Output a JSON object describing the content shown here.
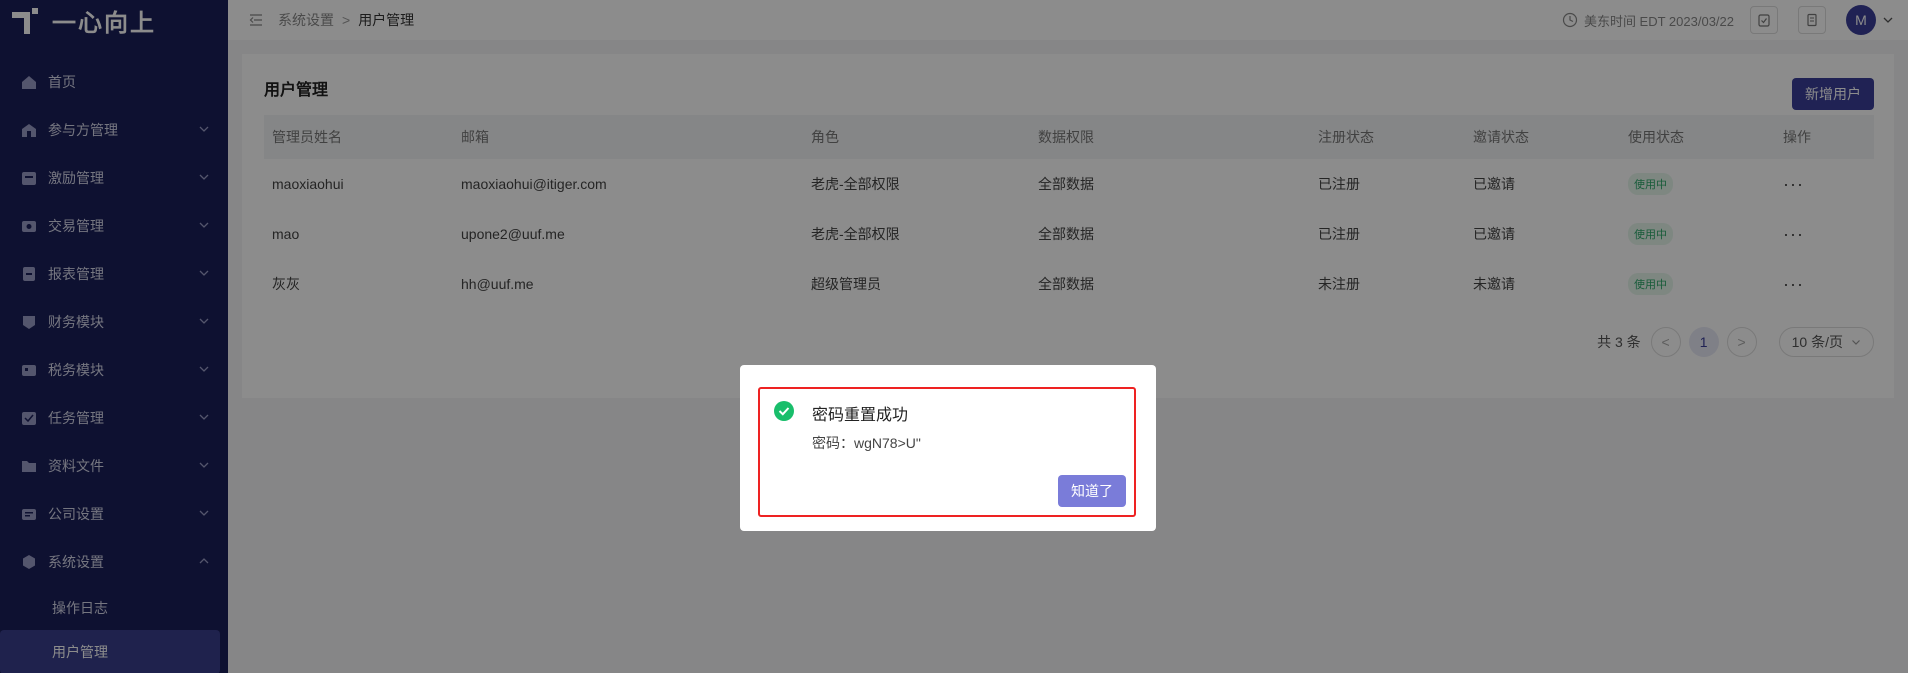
{
  "brand": {
    "name": "一心向上"
  },
  "sidebar": {
    "items": [
      {
        "label": "首页",
        "icon": "home-icon",
        "expandable": false
      },
      {
        "label": "参与方管理",
        "icon": "participants-icon",
        "expandable": true
      },
      {
        "label": "激励管理",
        "icon": "incentive-icon",
        "expandable": true
      },
      {
        "label": "交易管理",
        "icon": "trade-icon",
        "expandable": true
      },
      {
        "label": "报表管理",
        "icon": "report-icon",
        "expandable": true
      },
      {
        "label": "财务模块",
        "icon": "finance-icon",
        "expandable": true
      },
      {
        "label": "税务模块",
        "icon": "tax-icon",
        "expandable": true
      },
      {
        "label": "任务管理",
        "icon": "task-icon",
        "expandable": true
      },
      {
        "label": "资料文件",
        "icon": "files-icon",
        "expandable": true
      },
      {
        "label": "公司设置",
        "icon": "company-icon",
        "expandable": true
      },
      {
        "label": "系统设置",
        "icon": "settings-icon",
        "expandable": true,
        "expanded": true
      }
    ],
    "sub_items": [
      {
        "label": "操作日志",
        "active": false
      },
      {
        "label": "用户管理",
        "active": true
      }
    ]
  },
  "topbar": {
    "breadcrumb": [
      "系统设置",
      "用户管理"
    ],
    "breadcrumb_sep": ">",
    "time_text": "美东时间 EDT 2023/03/22",
    "avatar_letter": "M"
  },
  "page": {
    "title": "用户管理",
    "add_button": "新增用户"
  },
  "table": {
    "columns": [
      "管理员姓名",
      "邮箱",
      "角色",
      "数据权限",
      "注册状态",
      "邀请状态",
      "使用状态",
      "操作"
    ],
    "rows": [
      {
        "name": "maoxiaohui",
        "email": "maoxiaohui@itiger.com",
        "role": "老虎-全部权限",
        "data_scope": "全部数据",
        "reg_status": "已注册",
        "invite_status": "已邀请",
        "use_status": "使用中",
        "action": "···"
      },
      {
        "name": "mao",
        "email": "upone2@uuf.me",
        "role": "老虎-全部权限",
        "data_scope": "全部数据",
        "reg_status": "已注册",
        "invite_status": "已邀请",
        "use_status": "使用中",
        "action": "···"
      },
      {
        "name": "灰灰",
        "email": "hh@uuf.me",
        "role": "超级管理员",
        "data_scope": "全部数据",
        "reg_status": "未注册",
        "invite_status": "未邀请",
        "use_status": "使用中",
        "action": "···"
      }
    ]
  },
  "pagination": {
    "total_text": "共 3 条",
    "prev": "<",
    "current_page": "1",
    "next": ">",
    "page_size": "10 条/页"
  },
  "modal": {
    "title": "密码重置成功",
    "message": "密码：wgN78>U\"",
    "confirm": "知道了"
  },
  "colors": {
    "sidebar_bg": "#1b1f5a",
    "primary": "#3b3f9a",
    "success": "#19be6b",
    "highlight_border": "#e22222"
  }
}
